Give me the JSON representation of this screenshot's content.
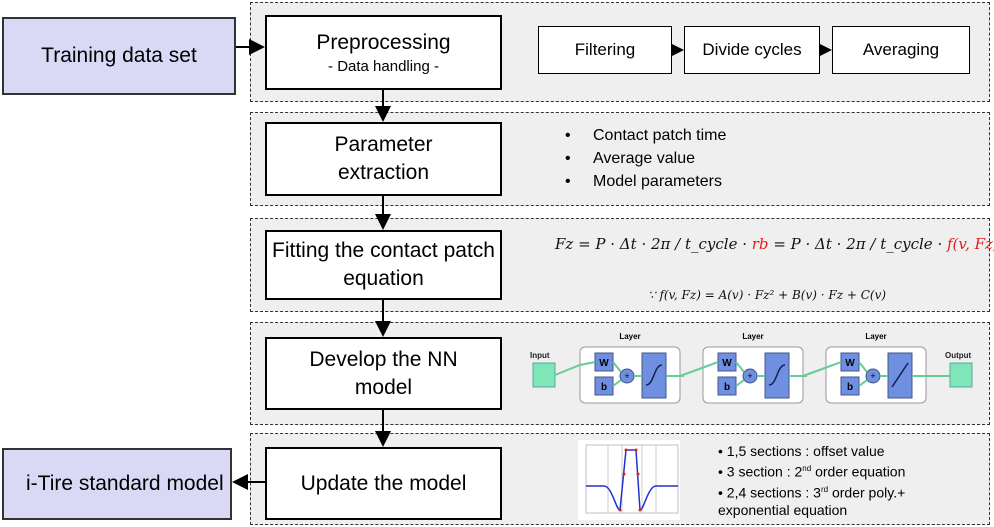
{
  "inputs": {
    "training": "Training data set",
    "output": "i-Tire standard model"
  },
  "steps": [
    {
      "title": "Preprocessing",
      "subtitle": "- Data handling -"
    },
    {
      "title": "Parameter extraction"
    },
    {
      "title": "Fitting the contact patch equation"
    },
    {
      "title": "Develop the NN model"
    },
    {
      "title": "Update the model"
    }
  ],
  "preprocessing_substeps": [
    "Filtering",
    "Divide cycles",
    "Averaging"
  ],
  "parameters": [
    "Contact patch time",
    "Average value",
    "Model parameters"
  ],
  "equation": {
    "main_lhs": "Fz = P · Δt · 2π / t_cycle · ",
    "rb": "rb",
    "mid": " = P · Δt · 2π / t_cycle · ",
    "f": "f(v, Fz)",
    "because": "∵ f(v, Fz) = A(v) · Fz² + B(v) · Fz + C(v)"
  },
  "nn": {
    "input": "Input",
    "output": "Output",
    "layer": "Layer",
    "w": "W",
    "b": "b",
    "plus": "+"
  },
  "update_notes": [
    {
      "pre": "1,5 sections : offset value",
      "sup": "",
      "post": ""
    },
    {
      "pre": "3 section : 2",
      "sup": "nd",
      "post": " order equation"
    },
    {
      "pre": "2,4 sections : 3",
      "sup": "rd",
      "post": " order poly.+"
    },
    {
      "pre": "exponential equation",
      "sup": "",
      "post": ""
    }
  ],
  "colors": {
    "lavender": "#d9d9f5",
    "panel": "#efefef",
    "nn_block": "#6f8fe0",
    "nn_io": "#7fe6b8",
    "red": "#e02020"
  }
}
